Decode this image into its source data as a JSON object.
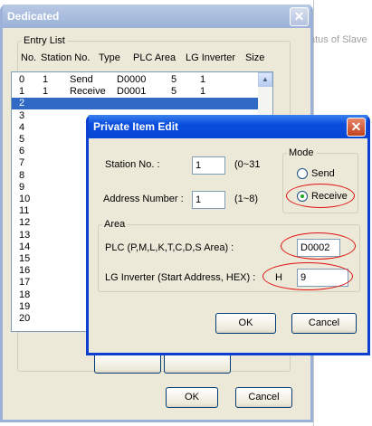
{
  "background": {
    "partial_text": "atus of Slave"
  },
  "main_dialog": {
    "title": "Dedicated",
    "entry_list": {
      "legend": "Entry List",
      "columns": [
        "No.",
        "Station No.",
        "Type",
        "PLC Area",
        "LG Inverter",
        "Size"
      ],
      "rows": [
        {
          "no": "0",
          "station": "1",
          "type": "Send",
          "plc": "D0000",
          "inverter": "5",
          "size": "1"
        },
        {
          "no": "1",
          "station": "1",
          "type": "Receive",
          "plc": "D0001",
          "inverter": "5",
          "size": "1"
        },
        {
          "no": "2"
        },
        {
          "no": "3"
        },
        {
          "no": "4"
        },
        {
          "no": "5"
        },
        {
          "no": "6"
        },
        {
          "no": "7"
        },
        {
          "no": "8"
        },
        {
          "no": "9"
        },
        {
          "no": "10"
        },
        {
          "no": "11"
        },
        {
          "no": "12"
        },
        {
          "no": "13"
        },
        {
          "no": "14"
        },
        {
          "no": "15"
        },
        {
          "no": "16"
        },
        {
          "no": "17"
        },
        {
          "no": "18"
        },
        {
          "no": "19"
        },
        {
          "no": "20"
        }
      ],
      "selected_row": "2"
    },
    "ok_label": "OK",
    "cancel_label": "Cancel"
  },
  "edit_dialog": {
    "title": "Private Item Edit",
    "station_label": "Station No. :",
    "station_value": "1",
    "station_range": "(0~31",
    "address_label": "Address Number :",
    "address_value": "1",
    "address_range": "(1~8)",
    "mode": {
      "legend": "Mode",
      "send_label": "Send",
      "receive_label": "Receive",
      "selected": "Receive"
    },
    "area": {
      "legend": "Area",
      "plc_label": "PLC (P,M,L,K,T,C,D,S Area) :",
      "plc_value": "D0002",
      "inverter_label": "LG Inverter (Start Address, HEX) :",
      "hex_prefix": "H",
      "inverter_value": "9"
    },
    "ok_label": "OK",
    "cancel_label": "Cancel"
  },
  "colors": {
    "annotation": "#e01010",
    "selection": "#316ac5",
    "titlebar": "#0a4ede"
  }
}
